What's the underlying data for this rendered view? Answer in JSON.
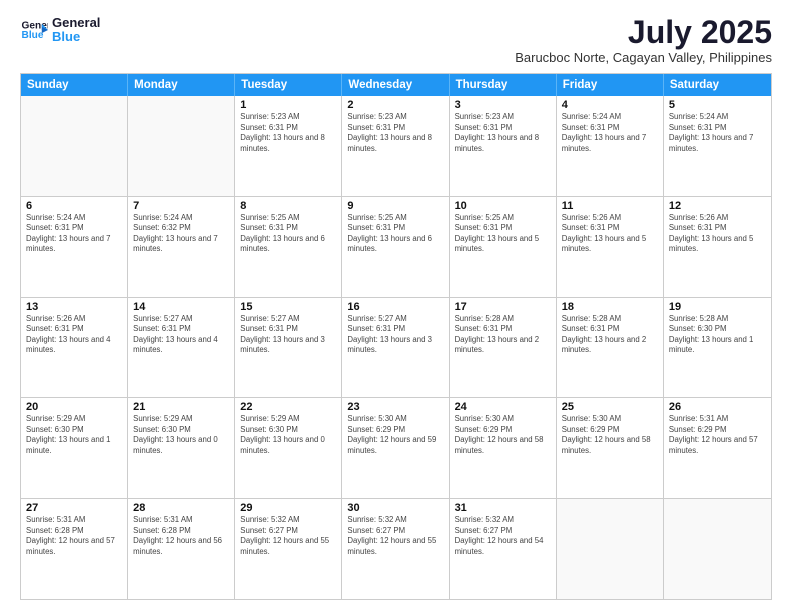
{
  "header": {
    "logo_line1": "General",
    "logo_line2": "Blue",
    "month": "July 2025",
    "location": "Barucboc Norte, Cagayan Valley, Philippines"
  },
  "weekdays": [
    "Sunday",
    "Monday",
    "Tuesday",
    "Wednesday",
    "Thursday",
    "Friday",
    "Saturday"
  ],
  "weeks": [
    [
      {
        "day": "",
        "info": ""
      },
      {
        "day": "",
        "info": ""
      },
      {
        "day": "1",
        "info": "Sunrise: 5:23 AM\nSunset: 6:31 PM\nDaylight: 13 hours and 8 minutes."
      },
      {
        "day": "2",
        "info": "Sunrise: 5:23 AM\nSunset: 6:31 PM\nDaylight: 13 hours and 8 minutes."
      },
      {
        "day": "3",
        "info": "Sunrise: 5:23 AM\nSunset: 6:31 PM\nDaylight: 13 hours and 8 minutes."
      },
      {
        "day": "4",
        "info": "Sunrise: 5:24 AM\nSunset: 6:31 PM\nDaylight: 13 hours and 7 minutes."
      },
      {
        "day": "5",
        "info": "Sunrise: 5:24 AM\nSunset: 6:31 PM\nDaylight: 13 hours and 7 minutes."
      }
    ],
    [
      {
        "day": "6",
        "info": "Sunrise: 5:24 AM\nSunset: 6:31 PM\nDaylight: 13 hours and 7 minutes."
      },
      {
        "day": "7",
        "info": "Sunrise: 5:24 AM\nSunset: 6:32 PM\nDaylight: 13 hours and 7 minutes."
      },
      {
        "day": "8",
        "info": "Sunrise: 5:25 AM\nSunset: 6:31 PM\nDaylight: 13 hours and 6 minutes."
      },
      {
        "day": "9",
        "info": "Sunrise: 5:25 AM\nSunset: 6:31 PM\nDaylight: 13 hours and 6 minutes."
      },
      {
        "day": "10",
        "info": "Sunrise: 5:25 AM\nSunset: 6:31 PM\nDaylight: 13 hours and 5 minutes."
      },
      {
        "day": "11",
        "info": "Sunrise: 5:26 AM\nSunset: 6:31 PM\nDaylight: 13 hours and 5 minutes."
      },
      {
        "day": "12",
        "info": "Sunrise: 5:26 AM\nSunset: 6:31 PM\nDaylight: 13 hours and 5 minutes."
      }
    ],
    [
      {
        "day": "13",
        "info": "Sunrise: 5:26 AM\nSunset: 6:31 PM\nDaylight: 13 hours and 4 minutes."
      },
      {
        "day": "14",
        "info": "Sunrise: 5:27 AM\nSunset: 6:31 PM\nDaylight: 13 hours and 4 minutes."
      },
      {
        "day": "15",
        "info": "Sunrise: 5:27 AM\nSunset: 6:31 PM\nDaylight: 13 hours and 3 minutes."
      },
      {
        "day": "16",
        "info": "Sunrise: 5:27 AM\nSunset: 6:31 PM\nDaylight: 13 hours and 3 minutes."
      },
      {
        "day": "17",
        "info": "Sunrise: 5:28 AM\nSunset: 6:31 PM\nDaylight: 13 hours and 2 minutes."
      },
      {
        "day": "18",
        "info": "Sunrise: 5:28 AM\nSunset: 6:31 PM\nDaylight: 13 hours and 2 minutes."
      },
      {
        "day": "19",
        "info": "Sunrise: 5:28 AM\nSunset: 6:30 PM\nDaylight: 13 hours and 1 minute."
      }
    ],
    [
      {
        "day": "20",
        "info": "Sunrise: 5:29 AM\nSunset: 6:30 PM\nDaylight: 13 hours and 1 minute."
      },
      {
        "day": "21",
        "info": "Sunrise: 5:29 AM\nSunset: 6:30 PM\nDaylight: 13 hours and 0 minutes."
      },
      {
        "day": "22",
        "info": "Sunrise: 5:29 AM\nSunset: 6:30 PM\nDaylight: 13 hours and 0 minutes."
      },
      {
        "day": "23",
        "info": "Sunrise: 5:30 AM\nSunset: 6:29 PM\nDaylight: 12 hours and 59 minutes."
      },
      {
        "day": "24",
        "info": "Sunrise: 5:30 AM\nSunset: 6:29 PM\nDaylight: 12 hours and 58 minutes."
      },
      {
        "day": "25",
        "info": "Sunrise: 5:30 AM\nSunset: 6:29 PM\nDaylight: 12 hours and 58 minutes."
      },
      {
        "day": "26",
        "info": "Sunrise: 5:31 AM\nSunset: 6:29 PM\nDaylight: 12 hours and 57 minutes."
      }
    ],
    [
      {
        "day": "27",
        "info": "Sunrise: 5:31 AM\nSunset: 6:28 PM\nDaylight: 12 hours and 57 minutes."
      },
      {
        "day": "28",
        "info": "Sunrise: 5:31 AM\nSunset: 6:28 PM\nDaylight: 12 hours and 56 minutes."
      },
      {
        "day": "29",
        "info": "Sunrise: 5:32 AM\nSunset: 6:27 PM\nDaylight: 12 hours and 55 minutes."
      },
      {
        "day": "30",
        "info": "Sunrise: 5:32 AM\nSunset: 6:27 PM\nDaylight: 12 hours and 55 minutes."
      },
      {
        "day": "31",
        "info": "Sunrise: 5:32 AM\nSunset: 6:27 PM\nDaylight: 12 hours and 54 minutes."
      },
      {
        "day": "",
        "info": ""
      },
      {
        "day": "",
        "info": ""
      }
    ]
  ]
}
